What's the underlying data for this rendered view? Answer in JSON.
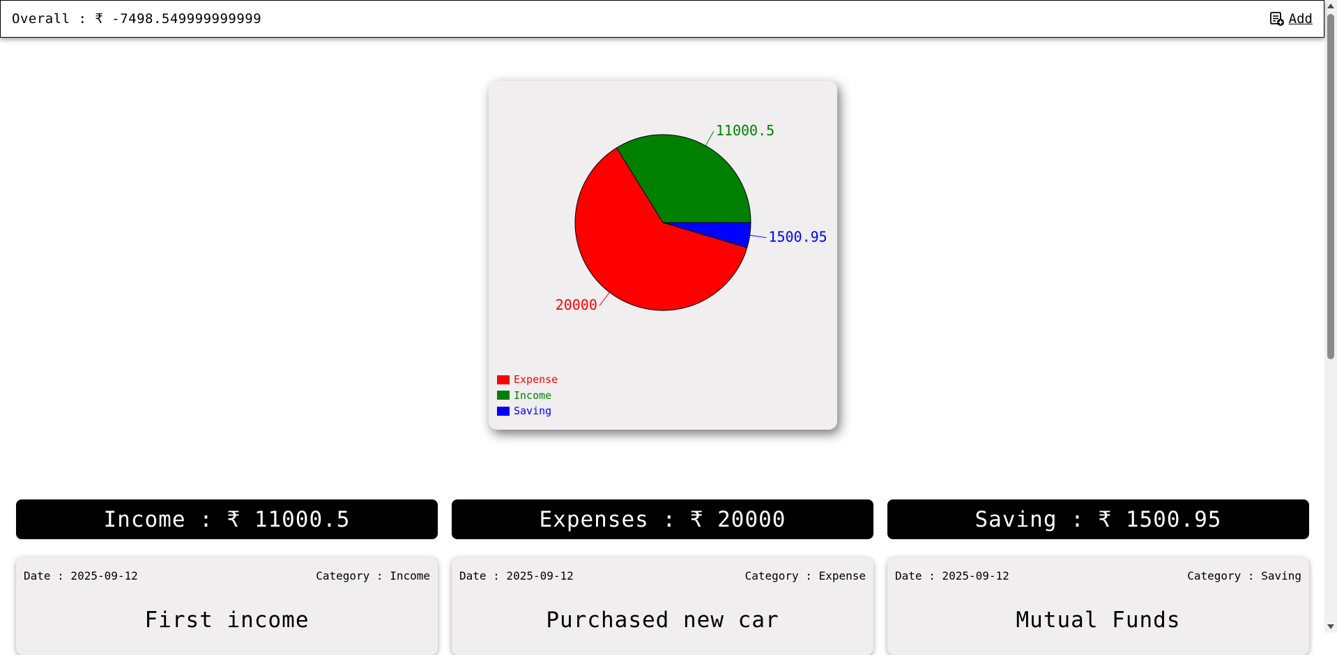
{
  "header": {
    "overall_label": "Overall : ₹ -7498.549999999999",
    "add_label": "Add"
  },
  "chart_data": {
    "type": "pie",
    "slices": [
      {
        "name": "Expense",
        "value": 20000,
        "label": "20000",
        "color": "#ff0000"
      },
      {
        "name": "Income",
        "value": 11000.5,
        "label": "11000.5",
        "color": "#008000"
      },
      {
        "name": "Saving",
        "value": 1500.95,
        "label": "1500.95",
        "color": "#0000ff"
      }
    ],
    "legend": [
      "Expense",
      "Income",
      "Saving"
    ],
    "legend_placement": "bottom-left"
  },
  "summary": [
    {
      "label": "Income : ₹ 11000.5"
    },
    {
      "label": "Expenses : ₹ 20000"
    },
    {
      "label": "Saving : ₹ 1500.95"
    }
  ],
  "entries": [
    {
      "date": "Date : 2025-09-12",
      "category": "Category : Income",
      "title": "First income"
    },
    {
      "date": "Date : 2025-09-12",
      "category": "Category : Expense",
      "title": "Purchased new car"
    },
    {
      "date": "Date : 2025-09-12",
      "category": "Category : Saving",
      "title": "Mutual Funds"
    }
  ]
}
